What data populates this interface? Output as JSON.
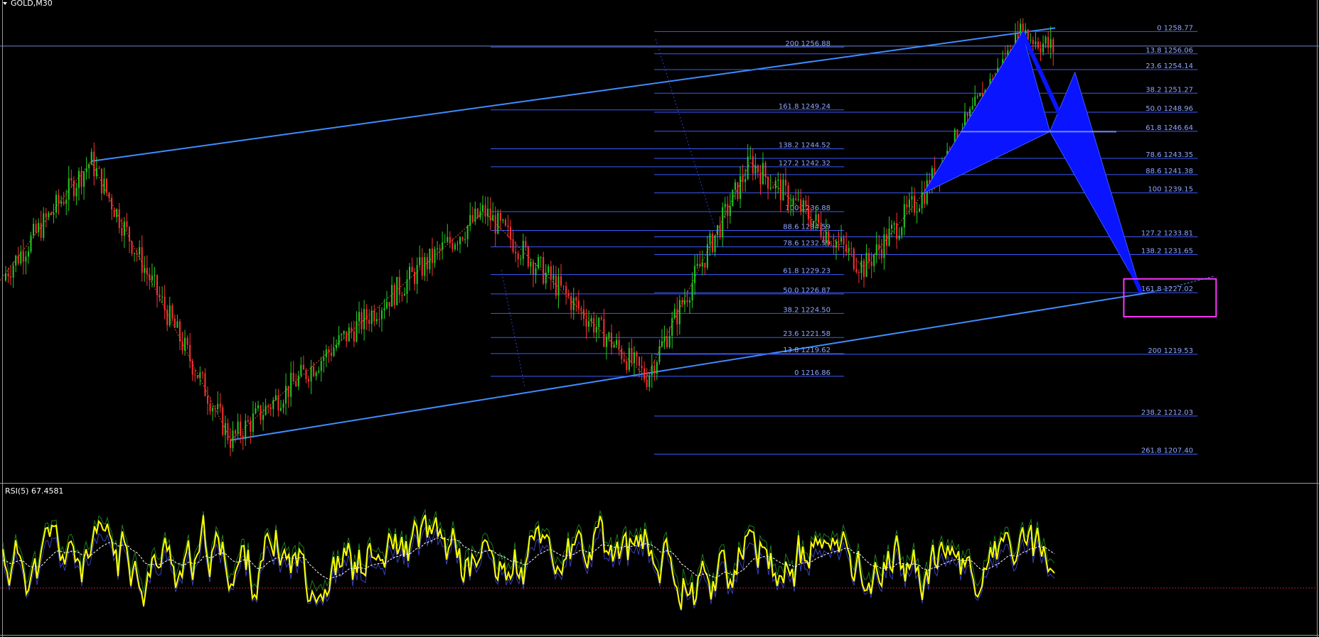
{
  "header": {
    "title": "GOLD,M30",
    "rsi_label": "RSI(5) 67.4581"
  },
  "colors": {
    "background": "#000000",
    "bull_candle": "#22cc22",
    "bear_candle": "#ff3030",
    "channel": "#3f8cff",
    "fib_line": "#3a5bff",
    "fib_label": "#8fa6ff",
    "pattern_fill": "#0a14ff",
    "zigzag": "#cc5a1a",
    "target_box": "#ff33ff",
    "rsi_line": "#ffff00",
    "rsi_signal": "#ffffff"
  },
  "chart_data": {
    "type": "candlestick",
    "symbol": "GOLD",
    "timeframe": "M30",
    "price_range": [
      1203.9,
      1262.6
    ],
    "channel": {
      "upper": {
        "from": [
          0.069,
          1243.0
        ],
        "to": [
          0.8,
          1259.2
        ]
      },
      "lower": {
        "from": [
          0.175,
          1209.1
        ],
        "to": [
          0.874,
          1227.1
        ]
      }
    },
    "fib_set_1": {
      "start": 0.372,
      "end": 0.64,
      "levels": [
        {
          "label": "200 1256.88",
          "price": 1256.88
        },
        {
          "label": "161.8 1249.24",
          "price": 1249.24
        },
        {
          "label": "138.2 1244.52",
          "price": 1244.52
        },
        {
          "label": "127.2 1242.32",
          "price": 1242.32
        },
        {
          "label": "100 1236.88",
          "price": 1236.88
        },
        {
          "label": "88.6 1234.59",
          "price": 1234.59
        },
        {
          "label": "78.6 1232.59",
          "price": 1232.59
        },
        {
          "label": "61.8 1229.23",
          "price": 1229.23
        },
        {
          "label": "50.0 1226.87",
          "price": 1226.87
        },
        {
          "label": "38.2 1224.50",
          "price": 1224.5
        },
        {
          "label": "23.6 1221.58",
          "price": 1221.58
        },
        {
          "label": "13.8 1219.62",
          "price": 1219.62
        },
        {
          "label": "0 1216.86",
          "price": 1216.86
        }
      ]
    },
    "fib_set_2": {
      "start": 0.496,
      "end": 0.908,
      "levels": [
        {
          "label": "0 1258.77",
          "price": 1258.77
        },
        {
          "label": "13.8 1256.06",
          "price": 1256.06
        },
        {
          "label": "23.6 1254.14",
          "price": 1254.14
        },
        {
          "label": "38.2 1251.27",
          "price": 1251.27
        },
        {
          "label": "50.0 1248.96",
          "price": 1248.96
        },
        {
          "label": "61.8 1246.64",
          "price": 1246.64
        },
        {
          "label": "78.6 1243.35",
          "price": 1243.35
        },
        {
          "label": "88.6 1241.38",
          "price": 1241.38
        },
        {
          "label": "100 1239.15",
          "price": 1239.15
        },
        {
          "label": "127.2 1233.81",
          "price": 1233.81
        },
        {
          "label": "138.2 1231.65",
          "price": 1231.65
        },
        {
          "label": "161.8 1227.02",
          "price": 1227.02
        },
        {
          "label": "200 1219.53",
          "price": 1219.53
        },
        {
          "label": "238.2 1212.03",
          "price": 1212.03
        },
        {
          "label": "261.8 1207.40",
          "price": 1207.4
        }
      ]
    },
    "harmonic_pattern": {
      "points": [
        [
          0.7,
          1239.1
        ],
        [
          0.775,
          1258.7
        ],
        [
          0.796,
          1246.6
        ],
        [
          0.815,
          1253.8
        ],
        [
          0.865,
          1227.1
        ]
      ]
    },
    "zigzag": [
      [
        0.0,
        1228.5
      ],
      [
        0.069,
        1243.0
      ],
      [
        0.175,
        1209.1
      ],
      [
        0.367,
        1236.9
      ],
      [
        0.49,
        1216.7
      ],
      [
        0.569,
        1242.9
      ],
      [
        0.655,
        1230.1
      ],
      [
        0.7,
        1239.1
      ],
      [
        0.775,
        1258.7
      ]
    ],
    "target_zone": {
      "x": [
        0.852,
        0.922
      ],
      "price": [
        1224.1,
        1228.7
      ]
    },
    "last_price": 1257.0,
    "rsi": {
      "period": 5,
      "value": 67.4581,
      "range": [
        0,
        100
      ],
      "level": 30
    }
  }
}
